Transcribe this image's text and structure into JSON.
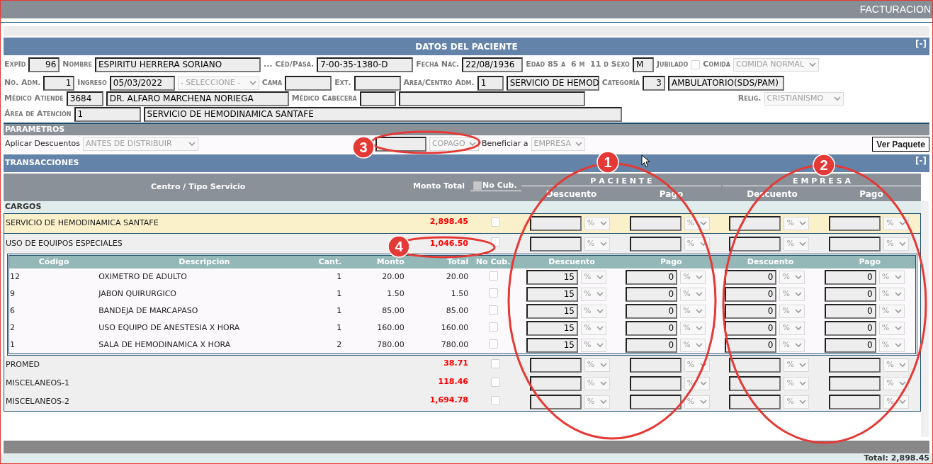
{
  "app_bar": {
    "title": "FACTURACION"
  },
  "patient": {
    "title": "DATOS DEL PACIENTE",
    "collapse": "[-]",
    "rows": [
      {
        "items": [
          {
            "kind": "label",
            "text": "ExpId"
          },
          {
            "kind": "input",
            "value": "96"
          },
          {
            "kind": "label",
            "text": "Nombre"
          },
          {
            "kind": "input",
            "value": "ESPIRITU HERRERA SORIANO"
          },
          {
            "kind": "label",
            "text": "..."
          },
          {
            "kind": "label",
            "text": "Céd/Pasa."
          },
          {
            "kind": "input",
            "value": "7-00-35-1380-D"
          },
          {
            "kind": "label",
            "text": "Fecha Nac."
          },
          {
            "kind": "input",
            "value": "22/08/1936"
          },
          {
            "kind": "label",
            "text": "Edad 85 a  6 m  11 d"
          },
          {
            "kind": "label",
            "text": "Sexo"
          },
          {
            "kind": "input",
            "value": "M"
          },
          {
            "kind": "label",
            "text": "Jubilado"
          },
          {
            "kind": "checkbox",
            "checked": false
          },
          {
            "kind": "label",
            "text": "Comida"
          },
          {
            "kind": "select",
            "value": "COMIDA NORMAL"
          }
        ]
      },
      {
        "items": [
          {
            "kind": "label",
            "text": "No. Adm."
          },
          {
            "kind": "input",
            "value": "1"
          },
          {
            "kind": "label",
            "text": "Ingreso"
          },
          {
            "kind": "input",
            "value": "05/03/2022"
          },
          {
            "kind": "select",
            "value": "- SELECCIONE -"
          },
          {
            "kind": "label",
            "text": "Cama"
          },
          {
            "kind": "input"
          },
          {
            "kind": "label",
            "text": "Ext."
          },
          {
            "kind": "input"
          },
          {
            "kind": "label",
            "text": "Area/Centro Adm."
          },
          {
            "kind": "input",
            "value": "1"
          },
          {
            "kind": "input",
            "value": "SERVICIO DE HEMOD"
          },
          {
            "kind": "label",
            "text": "Categoría"
          },
          {
            "kind": "input",
            "value": "3"
          },
          {
            "kind": "input",
            "value": "AMBULATORIO(SDS/PAM)"
          }
        ]
      },
      {
        "items": [
          {
            "kind": "label",
            "text": "Médico Atiende"
          },
          {
            "kind": "input",
            "value": "3684"
          },
          {
            "kind": "input",
            "value": "DR. ALFARO MARCHENA NORIEGA"
          },
          {
            "kind": "label",
            "text": "Médico Cabecera"
          },
          {
            "kind": "input"
          },
          {
            "kind": "input"
          },
          {
            "kind": "label",
            "text": "Relig."
          },
          {
            "kind": "select",
            "value": "CRISTIANISMO"
          }
        ]
      },
      {
        "items": [
          {
            "kind": "label",
            "text": "Área de Atención"
          },
          {
            "kind": "input",
            "value": "1"
          },
          {
            "kind": "input",
            "value": "SERVICIO DE HEMODINAMICA SANTAFE"
          }
        ]
      }
    ]
  },
  "parameters": {
    "title": "PARAMETROS",
    "items": [
      {
        "kind": "text",
        "text": "Aplicar Descuentos"
      },
      {
        "kind": "select",
        "value": "ANTES DE DISTRIBUIR"
      },
      {
        "kind": "input"
      },
      {
        "kind": "select",
        "value": "COPAGO"
      },
      {
        "kind": "text",
        "text": "Beneficiar a"
      },
      {
        "kind": "select",
        "value": "EMPRESA"
      },
      {
        "kind": "button",
        "text": "Ver Paquete"
      }
    ]
  },
  "transactions": {
    "title": "TRANSACCIONES",
    "collapse": "[-]",
    "columns": {
      "service": "Centro / Tipo Servicio",
      "total": "Monto Total",
      "no_cub": "No Cub.",
      "no_cub_checked": false,
      "groups": [
        {
          "title": "P A C I E N T E",
          "sub": [
            "Descuento",
            "Pago"
          ]
        },
        {
          "title": "E M P R E S A",
          "sub": [
            "Descuento",
            "Pago"
          ]
        }
      ]
    },
    "section": "CARGOS",
    "groups": [
      {
        "name": "SERVICIO DE HEMODINAMICA SANTAFE",
        "amount": "2,898.45",
        "no_cub": false,
        "selected": true,
        "expanded": false,
        "fields": [
          {
            "unit": "%"
          },
          {
            "unit": "%"
          },
          {
            "unit": "%"
          },
          {
            "unit": "%"
          }
        ]
      },
      {
        "name": "USO DE EQUIPOS ESPECIALES",
        "amount": "1,046.50",
        "no_cub": false,
        "selected": false,
        "expanded": true,
        "fields": [
          {
            "unit": "%"
          },
          {
            "unit": "%"
          },
          {
            "unit": "%"
          },
          {
            "unit": "%"
          }
        ],
        "detail": {
          "columns": [
            "Código",
            "Descripción",
            "Cant.",
            "Monto",
            "Total",
            "No Cub.",
            "Descuento",
            "Pago",
            "Descuento",
            "Pago"
          ],
          "rows": [
            {
              "codigo": "12",
              "descripcion": "OXIMETRO DE ADULTO",
              "cant": "1",
              "monto": "20.00",
              "total": "20.00",
              "no_cub": false,
              "fields": [
                {
                  "value": "15",
                  "unit": "%"
                },
                {
                  "value": "0",
                  "unit": "%"
                },
                {
                  "value": "0",
                  "unit": "%"
                },
                {
                  "value": "0",
                  "unit": "%"
                }
              ]
            },
            {
              "codigo": "9",
              "descripcion": "JABON QUIRURGICO",
              "cant": "1",
              "monto": "1.50",
              "total": "1.50",
              "no_cub": false,
              "fields": [
                {
                  "value": "15",
                  "unit": "%"
                },
                {
                  "value": "0",
                  "unit": "%"
                },
                {
                  "value": "0",
                  "unit": "%"
                },
                {
                  "value": "0",
                  "unit": "%"
                }
              ]
            },
            {
              "codigo": "6",
              "descripcion": "BANDEJA DE MARCAPASO",
              "cant": "1",
              "monto": "85.00",
              "total": "85.00",
              "no_cub": false,
              "fields": [
                {
                  "value": "15",
                  "unit": "%"
                },
                {
                  "value": "0",
                  "unit": "%"
                },
                {
                  "value": "0",
                  "unit": "%"
                },
                {
                  "value": "0",
                  "unit": "%"
                }
              ]
            },
            {
              "codigo": "2",
              "descripcion": "USO EQUIPO DE ANESTESIA X HORA",
              "cant": "1",
              "monto": "160.00",
              "total": "160.00",
              "no_cub": false,
              "fields": [
                {
                  "value": "15",
                  "unit": "%"
                },
                {
                  "value": "0",
                  "unit": "%"
                },
                {
                  "value": "0",
                  "unit": "%"
                },
                {
                  "value": "0",
                  "unit": "%"
                }
              ]
            },
            {
              "codigo": "1",
              "descripcion": "SALA DE HEMODINAMICA X HORA",
              "cant": "2",
              "monto": "780.00",
              "total": "780.00",
              "no_cub": false,
              "fields": [
                {
                  "value": "15",
                  "unit": "%"
                },
                {
                  "value": "0",
                  "unit": "%"
                },
                {
                  "value": "0",
                  "unit": "%"
                },
                {
                  "value": "0",
                  "unit": "%"
                }
              ]
            }
          ]
        }
      },
      {
        "name": "PROMED",
        "amount": "38.71",
        "no_cub": false,
        "selected": false,
        "expanded": false,
        "fields": [
          {
            "unit": "%"
          },
          {
            "unit": "%"
          },
          {
            "unit": "%"
          },
          {
            "unit": "%"
          }
        ]
      },
      {
        "name": "MISCELANEOS-1",
        "amount": "118.46",
        "no_cub": false,
        "selected": false,
        "expanded": false,
        "fields": [
          {
            "unit": "%"
          },
          {
            "unit": "%"
          },
          {
            "unit": "%"
          },
          {
            "unit": "%"
          }
        ]
      },
      {
        "name": "MISCELANEOS-2",
        "amount": "1,694.78",
        "no_cub": false,
        "selected": false,
        "expanded": false,
        "fields": [
          {
            "unit": "%"
          },
          {
            "unit": "%"
          },
          {
            "unit": "%"
          },
          {
            "unit": "%"
          }
        ]
      }
    ],
    "total": "Total: 2,898.45"
  },
  "annotations": [
    {
      "label": "1"
    },
    {
      "label": "2"
    },
    {
      "label": "3"
    },
    {
      "label": "4"
    }
  ]
}
